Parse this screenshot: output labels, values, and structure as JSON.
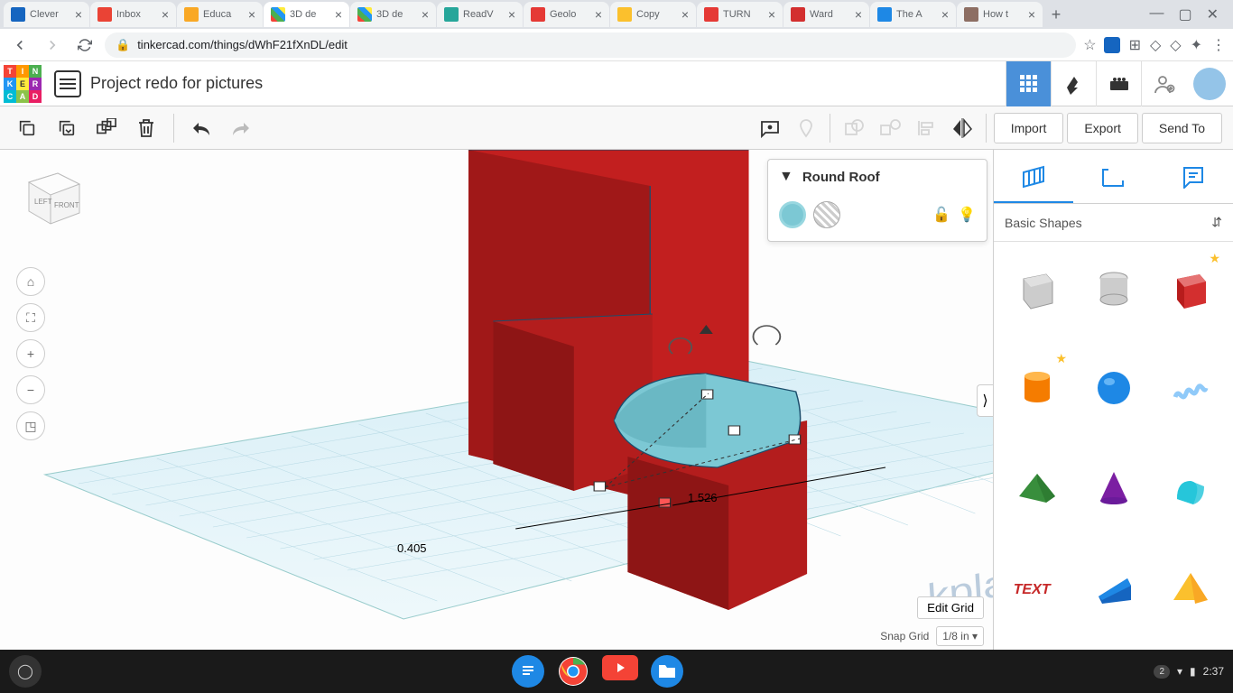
{
  "browser": {
    "tabs": [
      {
        "title": "Clever",
        "favicon": "#1565c0"
      },
      {
        "title": "Inbox",
        "favicon": "#ea4335"
      },
      {
        "title": "Educa",
        "favicon": "#f9a825"
      },
      {
        "title": "3D de",
        "favicon": "#multi"
      },
      {
        "title": "3D de",
        "favicon": "#multi"
      },
      {
        "title": "ReadV",
        "favicon": "#26a69a"
      },
      {
        "title": "Geolo",
        "favicon": "#e53935"
      },
      {
        "title": "Copy",
        "favicon": "#fbc02d"
      },
      {
        "title": "TURN",
        "favicon": "#e53935"
      },
      {
        "title": "Ward",
        "favicon": "#d32f2f"
      },
      {
        "title": "The A",
        "favicon": "#1e88e5"
      },
      {
        "title": "How t",
        "favicon": "#8d6e63"
      }
    ],
    "active_tab_index": 3,
    "url": "tinkercad.com/things/dWhF21fXnDL/edit"
  },
  "header": {
    "project_title": "Project redo for pictures"
  },
  "toolbar": {
    "import_label": "Import",
    "export_label": "Export",
    "send_to_label": "Send To"
  },
  "shape_panel": {
    "name": "Round Roof"
  },
  "sidebar": {
    "category": "Basic Shapes",
    "shapes": [
      {
        "name": "box-hole",
        "color": "#bdbdbd",
        "fav": false
      },
      {
        "name": "cylinder-hole",
        "color": "#bdbdbd",
        "fav": false
      },
      {
        "name": "box",
        "color": "#d32f2f",
        "fav": true
      },
      {
        "name": "cylinder",
        "color": "#f57c00",
        "fav": true
      },
      {
        "name": "sphere",
        "color": "#1e88e5",
        "fav": false
      },
      {
        "name": "scribble",
        "color": "#90caf9",
        "fav": false
      },
      {
        "name": "roof",
        "color": "#388e3c",
        "fav": false
      },
      {
        "name": "cone",
        "color": "#7b1fa2",
        "fav": false
      },
      {
        "name": "round-roof",
        "color": "#4dd0e1",
        "fav": false
      },
      {
        "name": "text",
        "color": "#c62828",
        "fav": false
      },
      {
        "name": "wedge",
        "color": "#1565c0",
        "fav": false
      },
      {
        "name": "pyramid",
        "color": "#fbc02d",
        "fav": false
      }
    ]
  },
  "dimensions": {
    "width": "0.405",
    "depth": "1.526"
  },
  "grid": {
    "edit_label": "Edit Grid",
    "snap_label": "Snap Grid",
    "snap_value": "1/8 in"
  },
  "shelf": {
    "notif_count": "2",
    "time": "2:37"
  },
  "viewcube": {
    "left": "LEFT",
    "front": "FRONT"
  }
}
